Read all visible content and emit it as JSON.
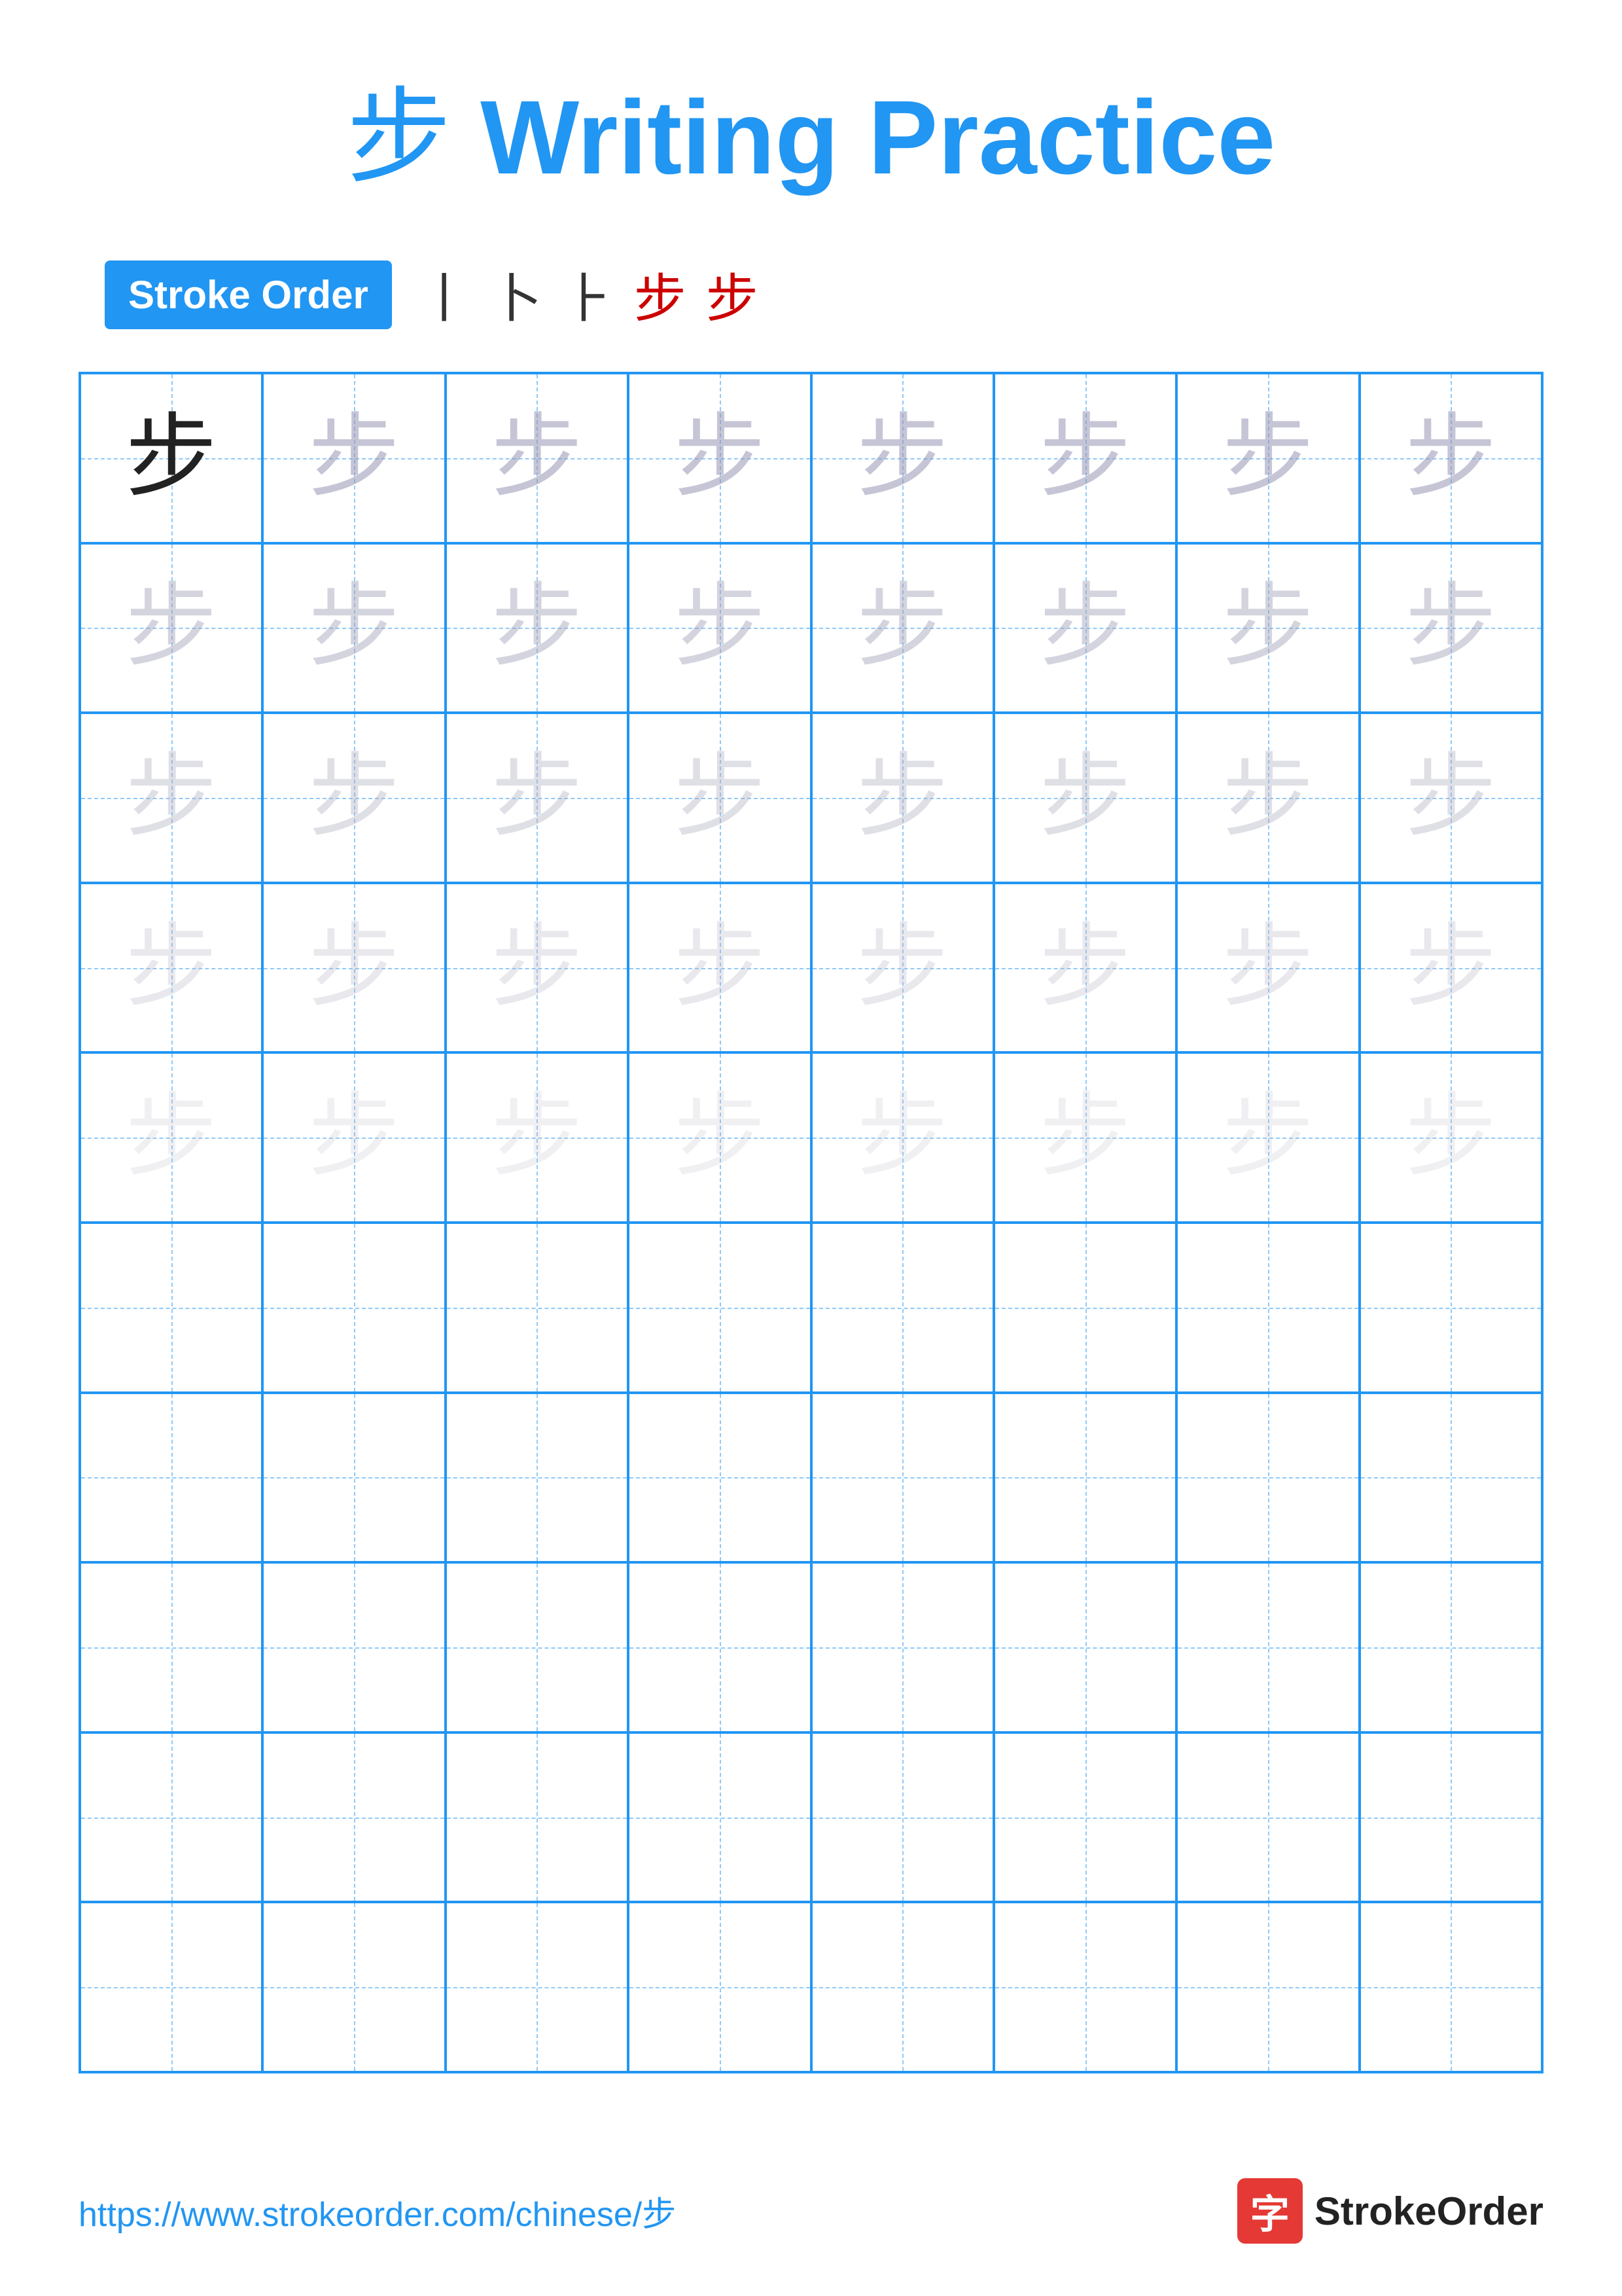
{
  "title": {
    "char": "步",
    "text": " Writing Practice"
  },
  "stroke_order": {
    "badge_label": "Stroke Order",
    "strokes": [
      "丨",
      "卜",
      "⺊",
      "步",
      "步"
    ]
  },
  "grid": {
    "rows": 10,
    "cols": 8,
    "practice_char": "步",
    "filled_rows": 5,
    "fade_levels": [
      "solid",
      "faded-1",
      "faded-2",
      "faded-3",
      "faded-4"
    ]
  },
  "footer": {
    "url": "https://www.strokeorder.com/chinese/步",
    "logo_char": "字",
    "logo_text": "StrokeOrder"
  }
}
